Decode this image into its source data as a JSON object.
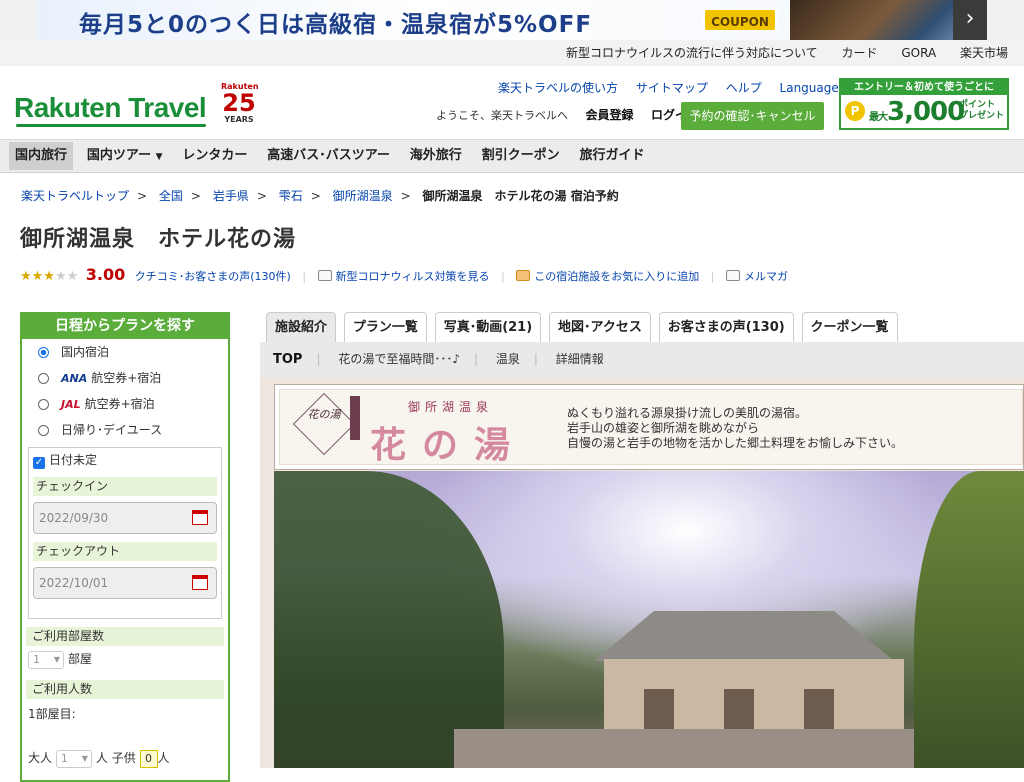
{
  "banner": {
    "text": "毎月5と0のつく日は高級宿・温泉宿が5%OFF",
    "coupon": "COUPON",
    "next_icon": "›"
  },
  "util_links": [
    "新型コロナウイルスの流行に伴う対応について",
    "カード",
    "GORA",
    "楽天市場"
  ],
  "header": {
    "logo": "Rakuten Travel",
    "years_brand": "Rakuten",
    "years_num": "25",
    "years_word": "YEARS",
    "links": [
      "楽天トラベルの使い方",
      "サイトマップ",
      "ヘルプ",
      "Languages"
    ],
    "welcome": "ようこそ、楽天トラベルへ",
    "register": "会員登録",
    "login": "ログイン",
    "reservation_button": "予約の確認･キャンセル",
    "entry_top": "エントリー＆初めて使うごとに",
    "entry_coin": "P",
    "entry_max": "最大",
    "entry_amount": "3,000",
    "entry_pt1": "ポイント",
    "entry_pt2": "プレゼント"
  },
  "nav": [
    "国内旅行",
    "国内ツアー",
    "レンタカー",
    "高速バス･バスツアー",
    "海外旅行",
    "割引クーポン",
    "旅行ガイド"
  ],
  "breadcrumb": [
    "楽天トラベルトップ",
    "全国",
    "岩手県",
    "雫石",
    "御所湖温泉",
    "御所湖温泉　ホテル花の湯 宿泊予約"
  ],
  "hotel": {
    "title": "御所湖温泉　ホテル花の湯",
    "score": "3.00",
    "reviews_link": "クチコミ･お客さまの声(130件)",
    "covid_link": "新型コロナウィルス対策を見る",
    "fav_link": "この宿泊施設をお気に入りに追加",
    "mail_link": "メルマガ"
  },
  "sidebar": {
    "title": "日程からプランを探す",
    "options": [
      {
        "label": "国内宿泊",
        "brand": ""
      },
      {
        "label": "航空券+宿泊",
        "brand": "ANA"
      },
      {
        "label": "航空券+宿泊",
        "brand": "JAL"
      },
      {
        "label": "日帰り･デイユース",
        "brand": ""
      }
    ],
    "undated": "日付未定",
    "checkin_label": "チェックイン",
    "checkin_value": "2022/09/30",
    "checkout_label": "チェックアウト",
    "checkout_value": "2022/10/01",
    "rooms_label": "ご利用部屋数",
    "rooms_value": "1",
    "rooms_unit": "部屋",
    "guests_label": "ご利用人数",
    "room1_label": "1部屋目:",
    "adult_label": "大人",
    "adult_value": "1",
    "adult_unit": "人",
    "child_label": "子供",
    "child_value": "0",
    "child_unit": "人"
  },
  "tabs": [
    "施設紹介",
    "プラン一覧",
    "写真･動画(21)",
    "地図･アクセス",
    "お客さまの声(130)",
    "クーポン一覧"
  ],
  "subnav": [
    "TOP",
    "花の湯で至福時間･･･♪",
    "温泉",
    "詳細情報"
  ],
  "header_image": {
    "logo_small": "花の湯",
    "name_small": "御所湖温泉",
    "name_big": "花の湯",
    "desc_lines": [
      "ぬくもり溢れる源泉掛け流しの美肌の湯宿。",
      "岩手山の雄姿と御所湖を眺めながら",
      "自慢の湯と岩手の地物を活かした郷土料理をお愉しみ下さい。"
    ]
  }
}
